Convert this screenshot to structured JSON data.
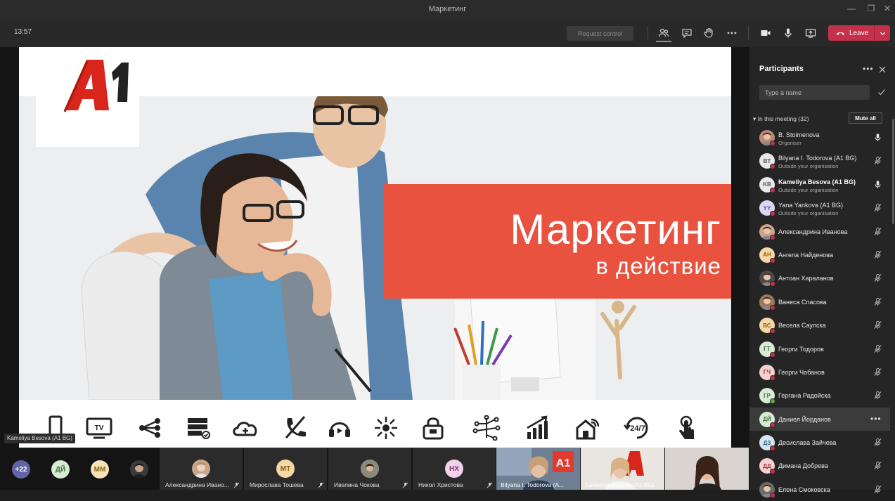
{
  "window": {
    "title": "Маркетинг",
    "minimize": "—",
    "maximize": "❐",
    "close": "✕"
  },
  "toolbar": {
    "time": "13:57",
    "request_control": "Request control",
    "leave": "Leave"
  },
  "slide": {
    "banner_line1": "Маркетинг",
    "banner_line2": "в действие",
    "icons": [
      "mobile-icon",
      "tv-icon",
      "share-icon",
      "server-icon",
      "cloud-icon",
      "phone-icon",
      "headset-icon",
      "network-icon",
      "lock-icon",
      "circuit-icon",
      "chart-icon",
      "smart-home-icon",
      "support-24-7-icon",
      "touch-icon"
    ]
  },
  "presenter_label": "Kameliya Besova (A1 BG)",
  "strip": {
    "overflow_count": "+22",
    "avatars": [
      {
        "initials": "ДЙ",
        "bg": "#d9ead6",
        "fg": "#3d6b35"
      },
      {
        "initials": "ММ",
        "bg": "#f6e3b8",
        "fg": "#8a6413"
      },
      {
        "initials": "",
        "bg": "#3a3a3a",
        "fg": "#fff"
      }
    ],
    "tiles": [
      {
        "name": "Александрина Ивано...",
        "initials": "",
        "bg": "#c9a58c"
      },
      {
        "name": "Мирослава Тошева",
        "initials": "МТ",
        "bg": "#f6d8a8",
        "fg": "#8a5a13"
      },
      {
        "name": "Ивелина Чокова",
        "initials": "",
        "bg": "#9a8a6e"
      },
      {
        "name": "Никол Христова",
        "initials": "НХ",
        "bg": "#f0d3ea",
        "fg": "#8a2f78"
      }
    ],
    "video_tiles": [
      {
        "name": "Bilyana I. Todorova (A..."
      },
      {
        "name": "Kameliya Besova (A1 BG)"
      },
      {
        "name": ""
      }
    ]
  },
  "panel": {
    "title": "Participants",
    "search_placeholder": "Type a name",
    "section": "In this meeting (32)",
    "mute_all": "Mute all",
    "participants": [
      {
        "name": "B. Stoimenova",
        "sub": "Organiser",
        "initials": "",
        "bg": "#b98a76",
        "dot": "#c4314b",
        "mic": "on"
      },
      {
        "name": "Bilyana I. Todorova (A1 BG)",
        "sub": "Outside your organisation",
        "initials": "BT",
        "bg": "#e8e8e8",
        "fg": "#555",
        "dot": "#c4314b",
        "mic": "off"
      },
      {
        "name": "Kameliya Besova (A1 BG)",
        "sub": "Outside your organisation",
        "initials": "KB",
        "bg": "#e8e8e8",
        "fg": "#555",
        "dot": "#c4314b",
        "mic": "on",
        "bold": true
      },
      {
        "name": "Yana Yankova (A1 BG)",
        "sub": "Outside your organisation",
        "initials": "YY",
        "bg": "#dcd7f0",
        "fg": "#5a4e9a",
        "dot": "#c4314b",
        "mic": "off"
      },
      {
        "name": "Александрина Иванова",
        "sub": "",
        "initials": "",
        "bg": "#c9a58c",
        "dot": "#c4314b",
        "mic": "off"
      },
      {
        "name": "Ангела Найденова",
        "sub": "",
        "initials": "АН",
        "bg": "#f6d8a8",
        "fg": "#8a5a13",
        "dot": "#c4314b",
        "mic": "off"
      },
      {
        "name": "Антоан Хараланов",
        "sub": "",
        "initials": "",
        "bg": "#4a4a4a",
        "dot": "#c4314b",
        "mic": "off"
      },
      {
        "name": "Ванеса Спасова",
        "sub": "",
        "initials": "",
        "bg": "#9a7a5e",
        "dot": "#c4314b",
        "mic": "off"
      },
      {
        "name": "Весела Саулска",
        "sub": "",
        "initials": "ВС",
        "bg": "#f6d8a8",
        "fg": "#8a5a13",
        "dot": "#c4314b",
        "mic": "off"
      },
      {
        "name": "Георги Тодоров",
        "sub": "",
        "initials": "ГТ",
        "bg": "#d9ead6",
        "fg": "#3d6b35",
        "dot": "#c4314b",
        "mic": "off"
      },
      {
        "name": "Георги Чобанов",
        "sub": "",
        "initials": "ГЧ",
        "bg": "#f6d0d0",
        "fg": "#9a3434",
        "dot": "#c4314b",
        "mic": "off"
      },
      {
        "name": "Гергана Радойска",
        "sub": "",
        "initials": "ГР",
        "bg": "#d9ead6",
        "fg": "#3d6b35",
        "dot": "#5fa84f",
        "mic": "off"
      },
      {
        "name": "Даниел Йорданов",
        "sub": "",
        "initials": "ДЙ",
        "bg": "#d9ead6",
        "fg": "#3d6b35",
        "dot": "#c4314b",
        "mic": "more",
        "highlight": true
      },
      {
        "name": "Десислава Зайчева",
        "sub": "",
        "initials": "ДЗ",
        "bg": "#d6e6f0",
        "fg": "#2f6a8a",
        "dot": "#c4314b",
        "mic": "off"
      },
      {
        "name": "Димана Добрева",
        "sub": "",
        "initials": "ДД",
        "bg": "#f6d0d0",
        "fg": "#9a3434",
        "dot": "#c4314b",
        "mic": "off"
      },
      {
        "name": "Елена Смоковска",
        "sub": "",
        "initials": "",
        "bg": "#6a6a6a",
        "dot": "#c4314b",
        "mic": "off"
      }
    ]
  },
  "colors": {
    "accent_red": "#e8523f",
    "leave_red": "#c4314b",
    "teams_purple": "#8b8cc7"
  }
}
